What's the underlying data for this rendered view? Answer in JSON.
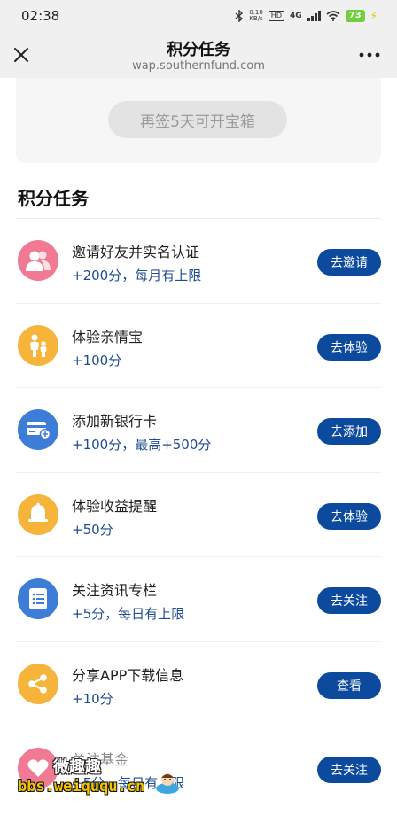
{
  "status_bar": {
    "time": "02:38",
    "net_speed_value": "0.10",
    "net_speed_unit": "KB/s",
    "hd": "HD",
    "network": "4G",
    "battery": "73"
  },
  "nav": {
    "title": "积分任务",
    "url": "wap.southernfund.com",
    "close_icon": "close-icon",
    "more_icon": "more-dots-icon"
  },
  "chest": {
    "button_label": "再签5天可开宝箱"
  },
  "section": {
    "title": "积分任务"
  },
  "tasks": [
    {
      "name": "邀请好友并实名认证",
      "reward": "+200分，每月有上限",
      "button": "去邀请",
      "icon": "invite-friends-icon",
      "color": "#f07a93"
    },
    {
      "name": "体验亲情宝",
      "reward": "+100分",
      "button": "去体验",
      "icon": "family-icon",
      "color": "#f6b43b"
    },
    {
      "name": "添加新银行卡",
      "reward": "+100分，最高+500分",
      "button": "去添加",
      "icon": "bank-card-icon",
      "color": "#3d7dd8"
    },
    {
      "name": "体验收益提醒",
      "reward": "+50分",
      "button": "去体验",
      "icon": "bell-icon",
      "color": "#f6b43b"
    },
    {
      "name": "关注资讯专栏",
      "reward": "+5分，每日有上限",
      "button": "去关注",
      "icon": "news-list-icon",
      "color": "#3d7dd8"
    },
    {
      "name": "分享APP下载信息",
      "reward": "+10分",
      "button": "查看",
      "icon": "share-icon",
      "color": "#f6b43b"
    },
    {
      "name": "关注基金",
      "reward": "+5分，每日有上限",
      "button": "去关注",
      "icon": "heart-icon",
      "color": "#f07a93"
    }
  ],
  "watermark": {
    "top": "微趣趣",
    "bottom": "bbs.weiququ.cn"
  }
}
